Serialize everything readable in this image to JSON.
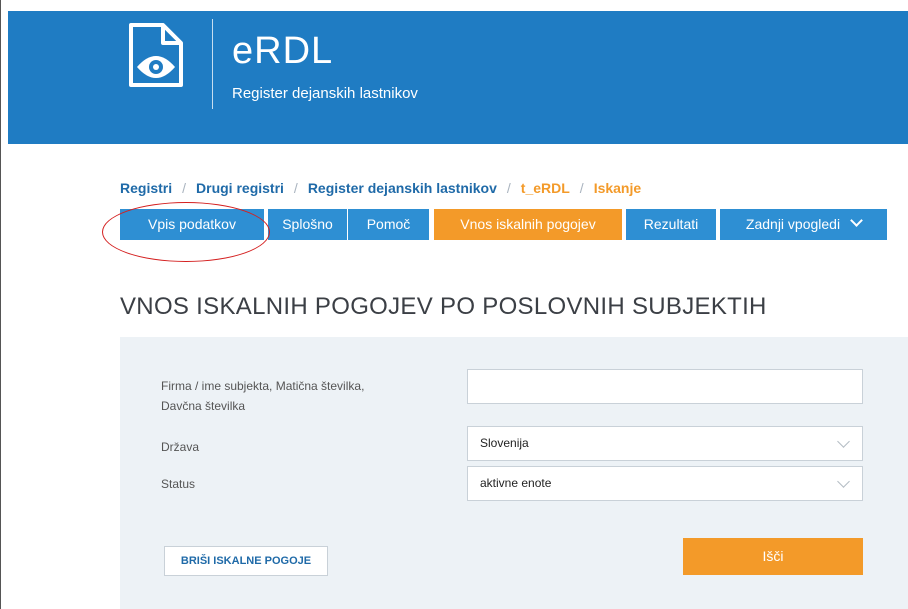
{
  "header": {
    "app_name": "eRDL",
    "app_subtitle": "Register dejanskih lastnikov",
    "logo_icon": "document-eye-icon",
    "background_color": "#1f7cc3"
  },
  "breadcrumb": [
    "Registri",
    "Drugi registri",
    "Register dejanskih lastnikov",
    "t_eRDL",
    "Iskanje"
  ],
  "breadcrumb_separator": "/",
  "tabs": [
    {
      "label": "Vpis podatkov"
    },
    {
      "label": "Splošno"
    },
    {
      "label": "Pomoč"
    },
    {
      "label": "Vnos iskalnih pogojev",
      "active": true
    },
    {
      "label": "Rezultati"
    },
    {
      "label": "Zadnji vpogledi"
    }
  ],
  "page_title": "VNOS ISKALNIH POGOJEV PO POSLOVNIH SUBJEKTIH",
  "form": {
    "company_label_line1": "Firma / ime subjekta, Matična številka,",
    "company_label_line2": "Davčna številka",
    "company_value": "",
    "country_label": "Država",
    "country_value": "Slovenija",
    "status_label": "Status",
    "status_value": "aktivne enote"
  },
  "buttons": {
    "clear": "BRIŠI ISKALNE POGOJE",
    "search": "Išči"
  },
  "colors": {
    "accent_orange": "#f39a29",
    "tab_blue": "#2e8fd3",
    "link_blue": "#1f6aa8",
    "annotation_red": "#d42020"
  }
}
